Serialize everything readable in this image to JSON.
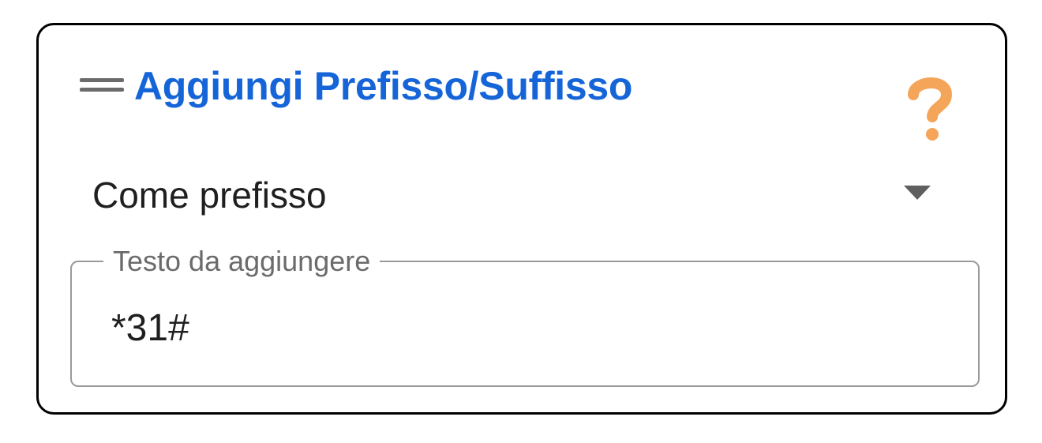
{
  "block": {
    "title": "Aggiungi Prefisso/Suffisso",
    "help_icon": "question-mark-icon",
    "drag_icon": "drag-handle-icon",
    "title_color": "#1565d8",
    "help_color": "#f5a55a"
  },
  "position_select": {
    "selected": "Come prefisso",
    "arrow_icon": "dropdown-arrow-icon"
  },
  "text_field": {
    "label": "Testo da aggiungere",
    "value": "*31#"
  }
}
